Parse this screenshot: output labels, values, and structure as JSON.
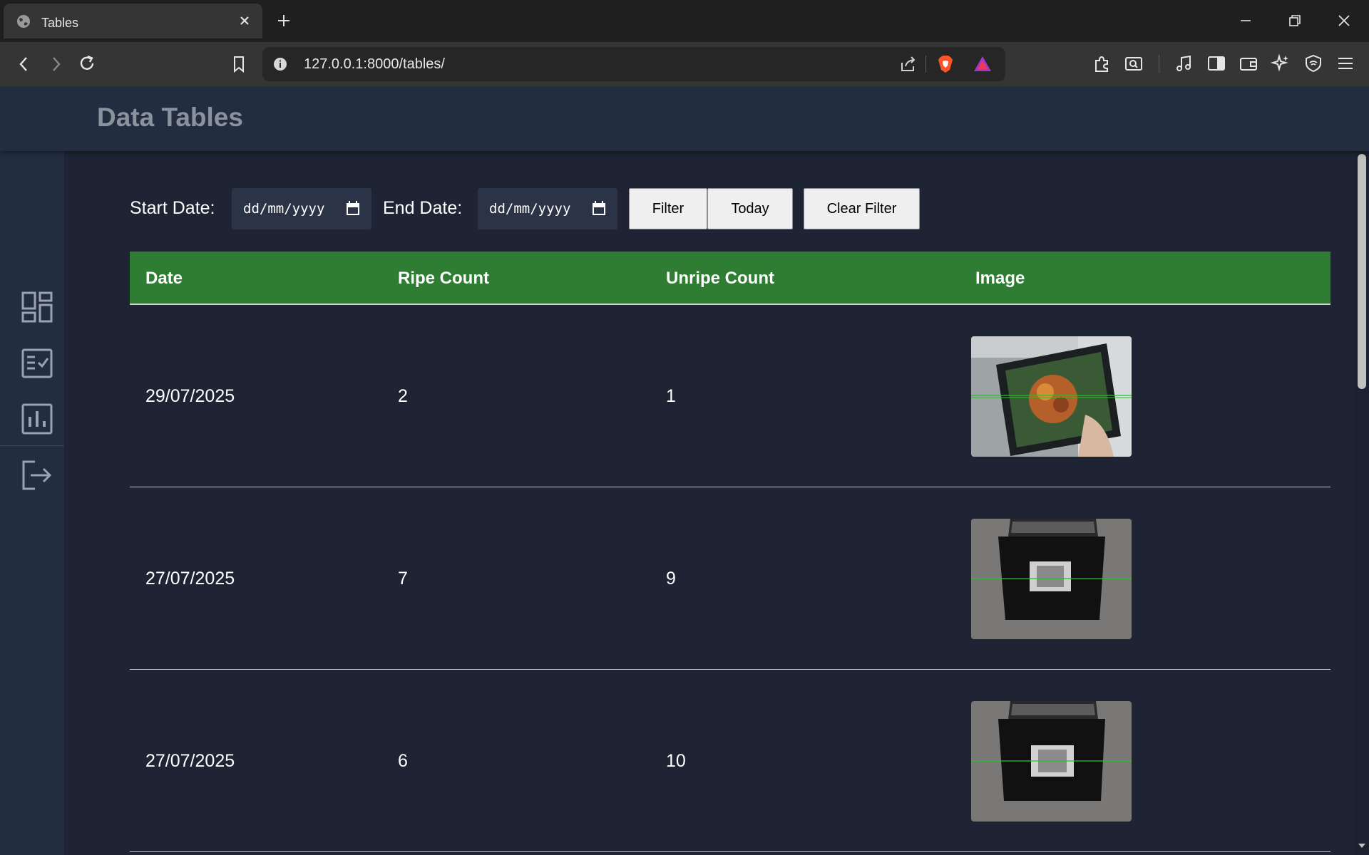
{
  "browser": {
    "tab_title": "Tables",
    "url": "127.0.0.1:8000/tables/"
  },
  "page": {
    "title": "Data Tables"
  },
  "sidebar": {
    "items": [
      {
        "icon": "dashboard-icon"
      },
      {
        "icon": "checklist-icon"
      },
      {
        "icon": "bar-chart-icon"
      },
      {
        "icon": "logout-icon"
      }
    ]
  },
  "filter": {
    "start_label": "Start Date:",
    "end_label": "End Date:",
    "start_placeholder": "dd/mm/yyyy",
    "end_placeholder": "dd/mm/yyyy",
    "filter_button": "Filter",
    "today_button": "Today",
    "clear_button": "Clear Filter"
  },
  "table": {
    "headers": [
      "Date",
      "Ripe Count",
      "Unripe Count",
      "Image"
    ],
    "rows": [
      {
        "date": "29/07/2025",
        "ripe": "2",
        "unripe": "1"
      },
      {
        "date": "27/07/2025",
        "ripe": "7",
        "unripe": "9"
      },
      {
        "date": "27/07/2025",
        "ripe": "6",
        "unripe": "10"
      }
    ]
  },
  "colors": {
    "header_green": "#2e7d32",
    "page_bg": "#1e2433",
    "panel_bg": "#232d40"
  }
}
